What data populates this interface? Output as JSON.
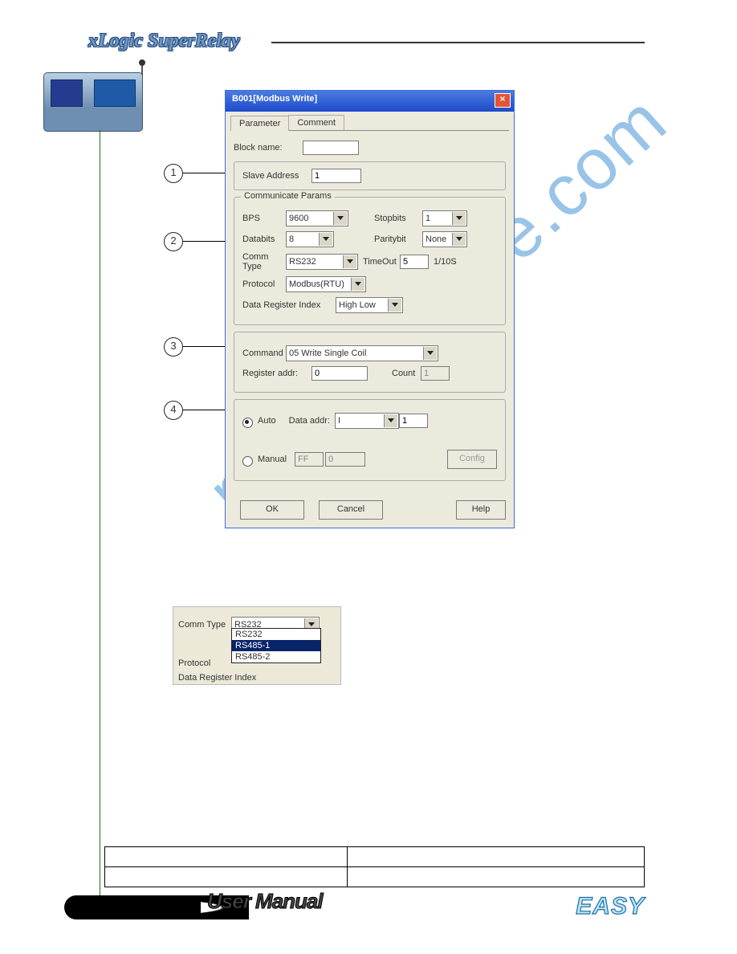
{
  "doc": {
    "brand": "xLogic SuperRelay",
    "footer": "User Manual",
    "logo": "EASY",
    "watermark": "manualshive.com"
  },
  "callouts": {
    "c1": "1",
    "c2": "2",
    "c3": "3",
    "c4": "4"
  },
  "dialog": {
    "title": "B001[Modbus Write]",
    "tabs": {
      "parameter": "Parameter",
      "comment": "Comment"
    },
    "block_name_label": "Block name:",
    "block_name_value": "",
    "group1": {
      "slave_address_label": "Slave Address",
      "slave_address_value": "1"
    },
    "group2": {
      "legend": "Communicate Params",
      "bps_label": "BPS",
      "bps_value": "9600",
      "stopbits_label": "Stopbits",
      "stopbits_value": "1",
      "databits_label": "Databits",
      "databits_value": "8",
      "paritybit_label": "Paritybit",
      "paritybit_value": "None",
      "commtype_label": "Comm Type",
      "commtype_value": "RS232",
      "timeout_label": "TimeOut",
      "timeout_value": "5",
      "timeout_unit": "1/10S",
      "protocol_label": "Protocol",
      "protocol_value": "Modbus(RTU)",
      "dri_label": "Data Register Index",
      "dri_value": "High Low"
    },
    "group3": {
      "command_label": "Command",
      "command_value": "05 Write Single Coil",
      "regaddr_label": "Register addr:",
      "regaddr_value": "0",
      "count_label": "Count",
      "count_value": "1"
    },
    "group4": {
      "auto_label": "Auto",
      "manual_label": "Manual",
      "data_addr_label": "Data addr:",
      "data_addr_type": "I",
      "data_addr_value": "1",
      "manual_hi": "FF",
      "manual_lo": "0",
      "config_btn": "Config"
    },
    "buttons": {
      "ok": "OK",
      "cancel": "Cancel",
      "help": "Help"
    }
  },
  "snippet": {
    "commtype_label": "Comm Type",
    "commtype_value": "RS232",
    "protocol_label": "Protocol",
    "dri_label": "Data Register Index",
    "options": {
      "o1": "RS232",
      "o2": "RS485-1",
      "o3": "RS485-2"
    }
  }
}
